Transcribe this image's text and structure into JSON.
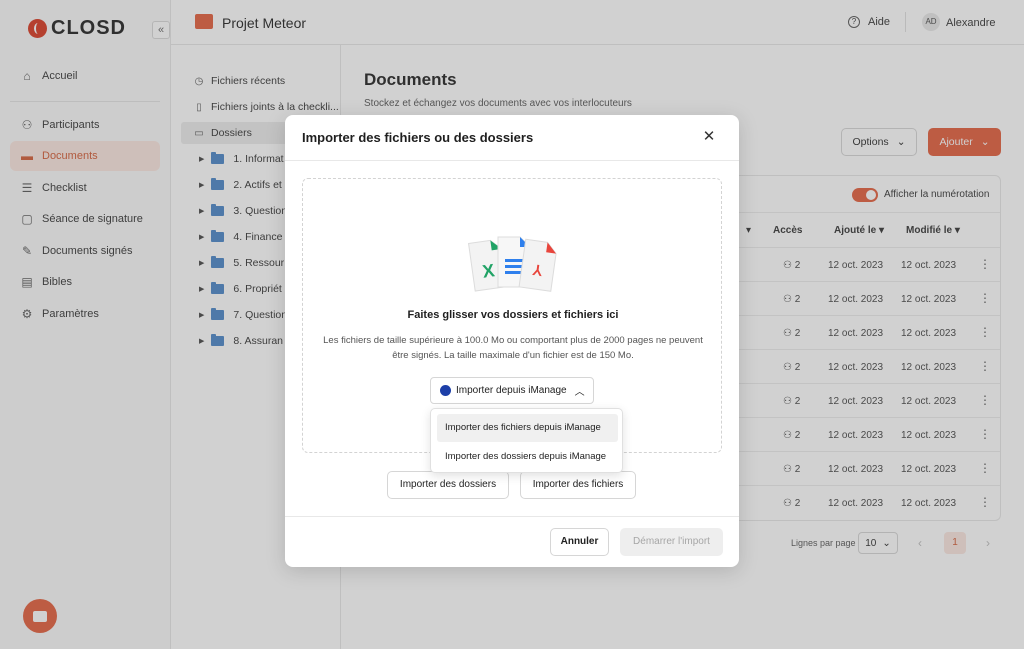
{
  "brand": {
    "name": "CLOSD"
  },
  "nav": {
    "collapse_label": "«",
    "items": [
      {
        "label": "Accueil",
        "icon": "home-icon"
      },
      {
        "label": "Participants",
        "icon": "users-icon"
      },
      {
        "label": "Documents",
        "icon": "folder-icon",
        "active": true
      },
      {
        "label": "Checklist",
        "icon": "checklist-icon"
      },
      {
        "label": "Séance de signature",
        "icon": "signature-icon"
      },
      {
        "label": "Documents signés",
        "icon": "signed-doc-icon"
      },
      {
        "label": "Bibles",
        "icon": "book-icon"
      },
      {
        "label": "Paramètres",
        "icon": "settings-icon"
      }
    ]
  },
  "topbar": {
    "project_title": "Projet Meteor",
    "help_label": "Aide",
    "user_initials": "AD",
    "user_name": "Alexandre"
  },
  "folders": {
    "recent": "Fichiers récents",
    "checklist_attachments": "Fichiers joints à la checkli...",
    "root": "Dossiers",
    "subfolders": [
      "1. Informat",
      "2. Actifs et",
      "3. Question",
      "4. Finance",
      "5. Ressour",
      "6. Propriét",
      "7. Question",
      "8. Assuran"
    ]
  },
  "main": {
    "title": "Documents",
    "subtitle": "Stockez et échangez vos documents avec vos interlocuteurs",
    "options_label": "Options",
    "add_label": "Ajouter",
    "numbering_label": "Afficher la numérotation",
    "numbering_on": true,
    "columns": {
      "access": "Accès",
      "added": "Ajouté le",
      "modified": "Modifié le"
    },
    "rows": [
      {
        "access": "2",
        "added": "12 oct. 2023",
        "modified": "12 oct. 2023"
      },
      {
        "access": "2",
        "added": "12 oct. 2023",
        "modified": "12 oct. 2023"
      },
      {
        "access": "2",
        "added": "12 oct. 2023",
        "modified": "12 oct. 2023"
      },
      {
        "access": "2",
        "added": "12 oct. 2023",
        "modified": "12 oct. 2023"
      },
      {
        "access": "2",
        "added": "12 oct. 2023",
        "modified": "12 oct. 2023"
      },
      {
        "access": "2",
        "added": "12 oct. 2023",
        "modified": "12 oct. 2023"
      },
      {
        "access": "2",
        "added": "12 oct. 2023",
        "modified": "12 oct. 2023"
      },
      {
        "access": "2",
        "added": "12 oct. 2023",
        "modified": "12 oct. 2023"
      }
    ],
    "rows_per_page_label": "Lignes par page",
    "rows_per_page": "10",
    "current_page": "1"
  },
  "modal": {
    "title": "Importer des fichiers ou des dossiers",
    "drop_title": "Faites glisser vos dossiers et fichiers ici",
    "drop_desc": "Les fichiers de taille supérieure à 100.0 Mo ou comportant plus de 2000 pages ne peuvent être signés. La taille maximale d'un fichier est de 150 Mo.",
    "imanage_label": "Importer depuis iManage",
    "imanage_menu": [
      "Importer des fichiers depuis iManage",
      "Importer des dossiers depuis iManage"
    ],
    "import_folders_label": "Importer des dossiers",
    "import_files_label": "Importer des fichiers",
    "cancel_label": "Annuler",
    "start_label": "Démarrer l'import"
  },
  "colors": {
    "accent": "#e35d3b",
    "accent_soft": "#fbe7df",
    "folder": "#4a86c8"
  }
}
